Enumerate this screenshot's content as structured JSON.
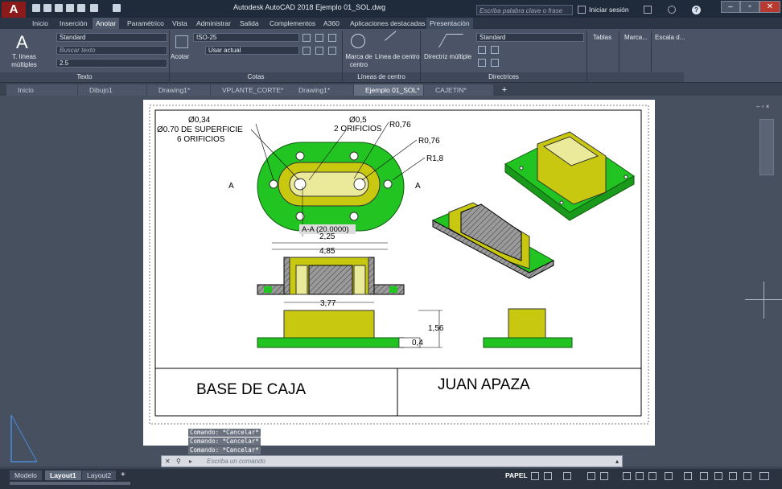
{
  "app": {
    "logo_letter": "A",
    "title": "Autodesk AutoCAD 2018    Ejemplo 01_SOL.dwg",
    "search_placeholder": "Escriba palabra clave o frase",
    "signin": "Iniciar sesión"
  },
  "ribbon_tabs": [
    "Inicio",
    "Inserción",
    "Anotar",
    "Paramétrico",
    "Vista",
    "Administrar",
    "Salida",
    "Complementos",
    "A360",
    "Aplicaciones destacadas",
    "Presentación"
  ],
  "active_ribbon_tab": "Anotar",
  "ribbon": {
    "texto": {
      "big_button": "T. líneas múltiples",
      "style": "Standard",
      "find_placeholder": "Buscar texto",
      "height": "2.5",
      "panel_label": "Texto"
    },
    "cotas": {
      "big_button": "Acotar",
      "dimstyle": "ISO-25",
      "layer": "Usar actual",
      "panel_label": "Cotas"
    },
    "centro": {
      "marca": "Marca de centro",
      "linea": "Línea de centro",
      "panel_label": "Líneas de centro"
    },
    "directrices": {
      "button": "Directriz múltiple",
      "style": "Standard",
      "panel_label": "Directrices"
    },
    "extra_panels": [
      "Tablas",
      "Marca...",
      "Escala d..."
    ]
  },
  "doc_tabs": [
    "Inicio",
    "Dibujo1",
    "Drawing1*",
    "VPLANTE_CORTE*",
    "Drawing1*",
    "Ejemplo 01_SOL*",
    "CAJETIN*"
  ],
  "active_doc_tab": "Ejemplo 01_SOL*",
  "drawing": {
    "note_hole1_a": "Ø0,34",
    "note_hole1_b": "Ø0.70 DE SUPERFICIE",
    "note_hole1_c": "6 ORIFICIOS",
    "note_hole2_a": "Ø0,5",
    "note_hole2_b": "2 ORIFICIOS",
    "r1": "R0,76",
    "r2": "R0,76",
    "r3": "R1,8",
    "section_left": "A",
    "section_right": "A",
    "section_label": "A-A (20.0000)",
    "dim_225": "2,25",
    "dim_485": "4,85",
    "dim_377": "3,77",
    "dim_156": "1,56",
    "dim_04": "0,4",
    "title_block_name": "BASE DE CAJA",
    "title_block_author": "JUAN APAZA"
  },
  "command": {
    "history": [
      "Comando: *Cancelar*",
      "Comando: *Cancelar*",
      "Comando: *Cancelar*"
    ],
    "placeholder": "Escriba un comando"
  },
  "layout_tabs": [
    "Modelo",
    "Layout1",
    "Layout2"
  ],
  "active_layout": "Layout1",
  "status": {
    "space": "PAPEL"
  },
  "colors": {
    "part_green": "#22c422",
    "part_yellow": "#c7c80f",
    "hatch": "#8c8c8c"
  }
}
